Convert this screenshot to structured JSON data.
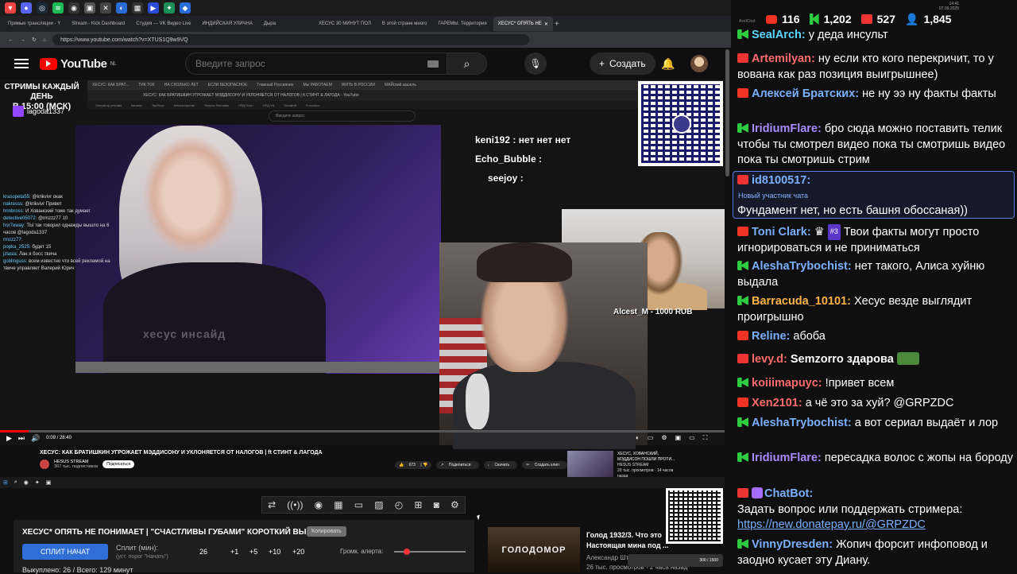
{
  "browser": {
    "tabs": [
      {
        "label": "Прямые трансляции - Y"
      },
      {
        "label": "Stream - Kick Dashboard"
      },
      {
        "label": "Студия — VK Видео Live"
      },
      {
        "label": "ИНДИЙСКАЯ УЛИЧНА"
      },
      {
        "label": "Дыра"
      },
      {
        "label": "ХЕСУС 30 МИНУТ ПОЛ"
      },
      {
        "label": "В этой стране много"
      },
      {
        "label": "ГАРЕМЫ. Территория"
      },
      {
        "label": "ХЕСУС* ОПЯТЬ НЕ",
        "active": true
      }
    ],
    "url": "https://www.youtube.com/watch?v=XTUS1Q9w9VQ"
  },
  "youtube": {
    "logo": "YouTube",
    "region": "NL",
    "search_placeholder": "Введите запрос",
    "create_label": "Создать"
  },
  "video": {
    "banner_line1": "СТРИМЫ КАЖДЫЙ ДЕНЬ",
    "banner_line2": "В 15:00 (МСК)",
    "twitch_name": "lagoda1337",
    "inner_search": "Введите запрос",
    "inner_title": "ХЕСУС: КАК БРАТИШКИН УГРОЖАЕТ МЭДДИСОНУ И УКЛОНЯЕТСЯ ОТ НАЛОГОВ | ft СТИНТ & ЛАГОДА - YouTube",
    "watermark": "хесус инсайд",
    "cam_caption": "Alcest_M - 1000 RUB",
    "overlay_chat": [
      {
        "text": "keni192 : нет нет нет"
      },
      {
        "text": "Echo_Bubble :"
      },
      {
        "text": "seejoy :"
      }
    ],
    "inner_chat": [
      {
        "name": "krasopeta55:",
        "text": "@krikvivr окак"
      },
      {
        "name": "nakresss:",
        "text": "@krikvivr Привет"
      },
      {
        "name": "hnnbross:",
        "text": "И Хованский тоже так думает"
      },
      {
        "name": "detective05072:",
        "text": "@rmzzz77 10"
      },
      {
        "name": "hor7eway:",
        "text": "ТЫ так говорил однажды вышло на 6 часов @lagoda1337"
      },
      {
        "name": "rmzzz77:",
        "text": ""
      },
      {
        "name": "popka_2525:",
        "text": "будет 15"
      },
      {
        "name": "jzlasia:",
        "text": "Лан я босс твича"
      },
      {
        "name": "goblinguss:",
        "text": "всем известно что всей рекламой на твиче управляет Валерий Юрич"
      }
    ],
    "time": "0:09 / 28:40",
    "title": "ХЕСУС: КАК БРАТИШКИН УГРОЖАЕТ МЭДДИСОНУ И УКЛОНЯЕТСЯ ОТ НАЛОГОВ | ft СТИНТ & ЛАГОДА",
    "channel": "HESUS STREAM",
    "subscribers": "367 тыс. подписчиков",
    "subscribe": "Подписаться",
    "likes": "673",
    "share": "Поделиться",
    "download": "Скачать",
    "clip": "Создать клип",
    "rec_title": "ХЕСУС, ХОВАНСКИЙ, МЭДДИСОН ПОШЛИ ПРОТИ...",
    "rec_channel": "HESUS STREAM",
    "rec_meta": "20 тыс. просмотров · 14 часов назад",
    "progress": 0.04
  },
  "panel": {
    "title": "ХЕСУС* ОПЯТЬ НЕ ПОНИМАЕТ | \"СЧАСТЛИВЫ ГУБАМИ\" КОРОТКИЙ ВЫПУСК",
    "copy_label": "Копировать",
    "split_button": "СПЛИТ НАЧАТ",
    "split_label": "Сплит (мин):",
    "split_hint": "(уст. порог \"Начать\")",
    "split_value": "26",
    "increments": [
      "+1",
      "+5",
      "+10",
      "+20"
    ],
    "volume_label": "Громк. алерта:",
    "volume_level": 0.18,
    "bought": "Выкуплено: 26 / Всего: 129 минут",
    "movie_thumb": "ГОЛОДОМОР",
    "movie_title": "Голод 1932/3. Что это Настоящая мина под ...",
    "movie_channel": "Александр Шт...",
    "movie_meta": "26 тыс. просмотров · 2 часа назад",
    "qr_bar": "300 / 1500"
  },
  "chat": {
    "counts": {
      "youtube": "116",
      "twitch": "1,202",
      "vk": "527",
      "viewers": "1,845"
    },
    "tray_time": "14:41",
    "tray_date": "07.09.2025",
    "new_member": "Новый участник чата",
    "messages": [
      {
        "platform": "tw",
        "user": "SealArch:",
        "color": "#5ad6ff",
        "text": "у деда инсульт"
      },
      {
        "platform": "vk",
        "user": "Artemilyan:",
        "color": "#ff6b6b",
        "text": "ну если кто кого перекричит, то у вована как раз позиция выигрышнее)"
      },
      {
        "platform": "yt",
        "user": "Алексей Братских:",
        "color": "#7ab0ff",
        "text": "не ну ээ ну факты факты"
      },
      {
        "platform": "tw",
        "user": "IridiumFlare:",
        "color": "#a78bff",
        "text": "бро сюда можно поставить телик чтобы ты смотрел видео пока ты смотришь видео пока ты смотришь стрим"
      },
      {
        "platform": "vk",
        "user": "id8100517:",
        "color": "#7ab0ff",
        "text": "Фундамент нет, но есть башня обоссаная))"
      },
      {
        "platform": "yt",
        "user": "Toni Clark:",
        "color": "#7ab0ff",
        "text": "Твои факты могут просто игнорироваться и не приниматься",
        "rank": "#3"
      },
      {
        "platform": "tw",
        "user": "AleshaTrybochist:",
        "color": "#7ab0ff",
        "text": "нет такого, Алиса хуйню выдала"
      },
      {
        "platform": "tw",
        "user": "Barracuda_10101:",
        "color": "#ffb347",
        "text": "Хесус везде выглядит проигрышно"
      },
      {
        "platform": "yt",
        "user": "Reline:",
        "color": "#7ab0ff",
        "text": "абоба"
      },
      {
        "platform": "vk",
        "user": "levy.d:",
        "color": "#ff6b6b",
        "text": "Semzorro здарова",
        "bold_prefix": ""
      },
      {
        "platform": "tw",
        "user": "koiiimapuyc:",
        "color": "#ff6b6b",
        "text": "!привет всем"
      },
      {
        "platform": "yt",
        "user": "Xen2101:",
        "color": "#ff6b6b",
        "text": "а чё это за хуй? @GRPZDC"
      },
      {
        "platform": "tw",
        "user": "AleshaTrybochist:",
        "color": "#7ab0ff",
        "text": "а вот сериал выдаёт и лор"
      },
      {
        "platform": "tw",
        "user": "IridiumFlare:",
        "color": "#a78bff",
        "text": "пересадка волос с жопы на бороду"
      },
      {
        "platform": "vk",
        "user": "ChatBot:",
        "color": "#7ab0ff",
        "text": "Задать вопрос или поддержать стримера:"
      },
      {
        "platform": "tw",
        "user": "VinnyDresden:",
        "color": "#7ab0ff",
        "text": "Жопич форсит инфоповод и заодно кусает эту Диану."
      }
    ],
    "donate_link": "https://new.donatepay.ru/@GRPZDC"
  }
}
